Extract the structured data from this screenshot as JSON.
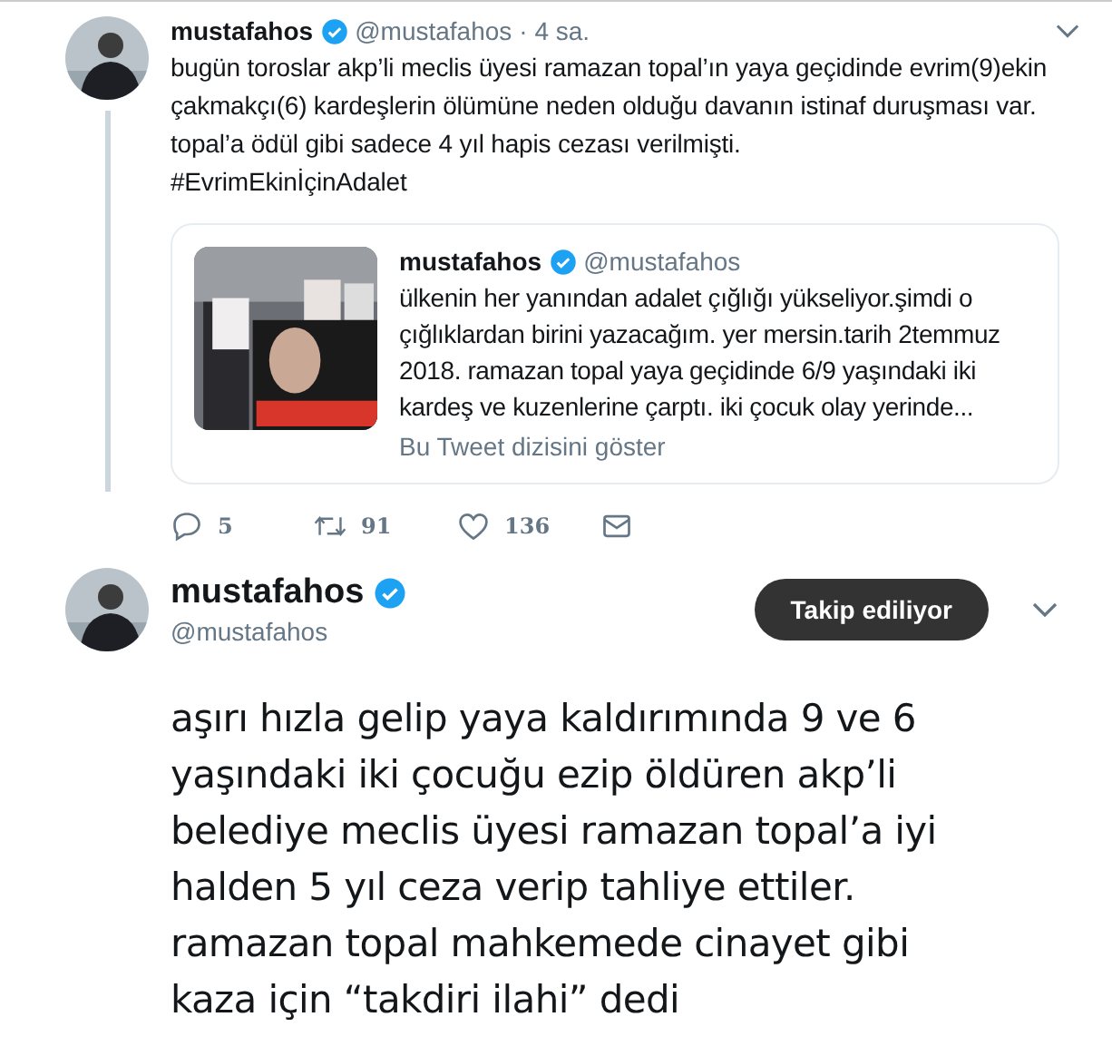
{
  "tweet": {
    "name": "mustafahos",
    "verified": true,
    "handle": "@mustafahos",
    "time": "· 4 sa.",
    "text": "bugün toroslar akp’li meclis üyesi ramazan topal’ın yaya geçidinde evrim(9)ekin\nçakmakçı(6) kardeşlerin ölümüne neden olduğu davanın istinaf duruşması var.\ntopal’a ödül gibi sadece 4 yıl hapis cezası verilmişti.\n#EvrimEkinİçinAdalet",
    "quote": {
      "name": "mustafahos",
      "verified": true,
      "handle": "@mustafahos",
      "text": "ülkenin her yanından adalet çığlığı yükseliyor.şimdi o\nçığlıklardan birini yazacağım. yer mersin.tarih 2temmuz\n2018. ramazan topal yaya geçidinde 6/9 yaşındaki iki\nkardeş ve kuzenlerine çarptı. iki çocuk olay yerinde...",
      "thread_link": "Bu Tweet dizisini göster"
    },
    "actions": [
      {
        "kind": "reply",
        "count": "5"
      },
      {
        "kind": "retweet",
        "count": "91"
      },
      {
        "kind": "like",
        "count": "136"
      },
      {
        "kind": "message"
      }
    ]
  },
  "main": {
    "name": "mustafahos",
    "verified": true,
    "handle": "@mustafahos",
    "follow_button": "Takip ediliyor",
    "text": "aşırı hızla gelip yaya kaldırımında 9 ve 6\nyaşındaki iki çocuğu ezip öldüren akp’li\nbelediye meclis üyesi ramazan topal’a iyi\nhalden 5 yıl ceza verip tahliye ettiler.\nramazan topal mahkemede cinayet gibi\nkaza için “takdiri ilahi” dedi"
  }
}
